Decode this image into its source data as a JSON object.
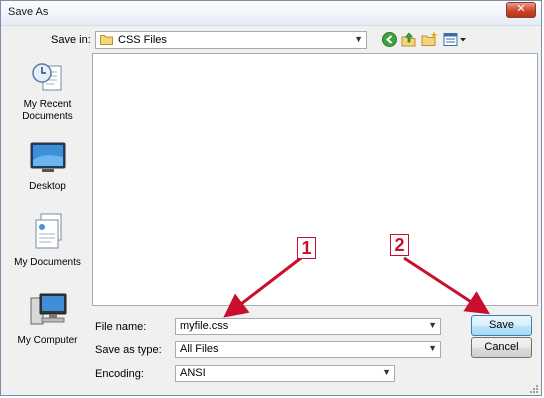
{
  "window": {
    "title": "Save As"
  },
  "toolbar": {
    "save_in_label": "Save in:",
    "folder_value": "CSS Files",
    "icons": [
      "back-icon",
      "up-folder-icon",
      "new-folder-icon",
      "views-menu-icon"
    ]
  },
  "places": [
    {
      "label_lines": [
        "My Recent",
        "Documents"
      ],
      "icon": "recent-documents-icon"
    },
    {
      "label_lines": [
        "Desktop"
      ],
      "icon": "desktop-icon"
    },
    {
      "label_lines": [
        "My Documents"
      ],
      "icon": "my-documents-icon"
    },
    {
      "label_lines": [
        "My Computer"
      ],
      "icon": "my-computer-icon"
    }
  ],
  "form": {
    "file_name_label": "File name:",
    "file_name_value": "myfile.css",
    "save_as_type_label": "Save as type:",
    "save_as_type_value": "All Files",
    "encoding_label": "Encoding:",
    "encoding_value": "ANSI"
  },
  "buttons": {
    "save": "Save",
    "cancel": "Cancel"
  },
  "annotations": {
    "callout_1": "1",
    "callout_2": "2",
    "accent_color": "#c8102e"
  },
  "colors": {
    "title_bar": "#e6ecf4",
    "dialog_bg": "#f0f0f0",
    "close_button": "#c9452e"
  }
}
